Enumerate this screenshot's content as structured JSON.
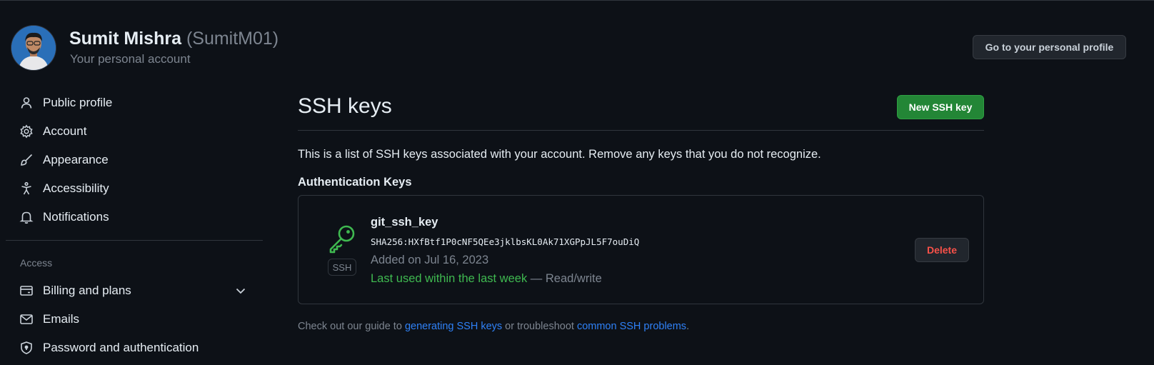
{
  "header": {
    "name": "Sumit Mishra",
    "login": "(SumitM01)",
    "subtitle": "Your personal account",
    "profile_button": "Go to your personal profile"
  },
  "sidebar": {
    "items": [
      {
        "label": "Public profile",
        "icon": "person-icon"
      },
      {
        "label": "Account",
        "icon": "gear-icon"
      },
      {
        "label": "Appearance",
        "icon": "paintbrush-icon"
      },
      {
        "label": "Accessibility",
        "icon": "accessibility-icon"
      },
      {
        "label": "Notifications",
        "icon": "bell-icon"
      }
    ],
    "access_heading": "Access",
    "access_items": [
      {
        "label": "Billing and plans",
        "icon": "credit-card-icon",
        "chevron": "chevron-down-icon"
      },
      {
        "label": "Emails",
        "icon": "mail-icon"
      },
      {
        "label": "Password and authentication",
        "icon": "shield-lock-icon"
      }
    ]
  },
  "main": {
    "title": "SSH keys",
    "new_button": "New SSH key",
    "intro": "This is a list of SSH keys associated with your account. Remove any keys that you do not recognize.",
    "section_heading": "Authentication Keys",
    "key": {
      "icon": "key-icon",
      "badge": "SSH",
      "name": "git_ssh_key",
      "fingerprint": "SHA256:HXfBtf1P0cNF5QEe3jklbsKL0Ak71XGPpJL5F7ouDiQ",
      "added": "Added on Jul 16, 2023",
      "last_used": "Last used within the last week",
      "access": " — Read/write",
      "delete_button": "Delete"
    },
    "guide": {
      "prefix": "Check out our guide to ",
      "link1": "generating SSH keys",
      "middle": " or troubleshoot ",
      "link2": "common SSH problems",
      "suffix": "."
    }
  },
  "colors": {
    "background": "#0d1117",
    "border": "#30363d",
    "muted": "#7d8590",
    "accent_green": "#238636",
    "success_text": "#3fb950",
    "danger": "#f85149",
    "link": "#2f81f7"
  }
}
